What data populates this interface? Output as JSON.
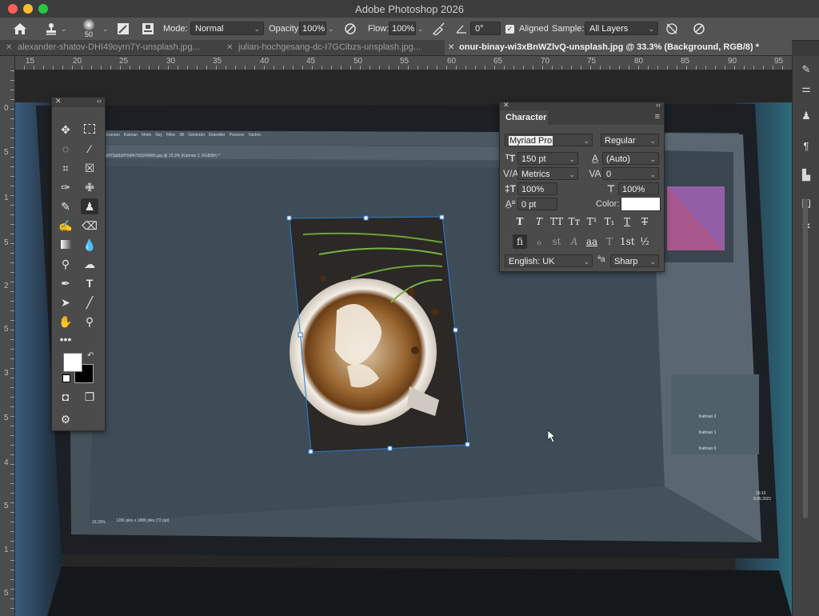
{
  "app": {
    "title": "Adobe Photoshop 2026"
  },
  "options_bar": {
    "brush_size": "50",
    "mode_label": "Mode:",
    "mode_value": "Normal",
    "opacity_label": "Opacity:",
    "opacity_value": "100%",
    "flow_label": "Flow:",
    "flow_value": "100%",
    "angle_value": "0°",
    "aligned_label": "Aligned",
    "sample_label": "Sample:",
    "sample_value": "All Layers"
  },
  "tabs": [
    {
      "label": "alexander-shatov-DHI49oyrn7Y-unsplash.jpg..."
    },
    {
      "label": "julian-hochgesang-dc-I7GCibzs-unsplash.jpg..."
    },
    {
      "label": "onur-binay-wi3xBnWZlvQ-unsplash.jpg @ 33.3% (Background, RGB/8) *"
    }
  ],
  "ruler": {
    "h_ticks": [
      "15",
      "20",
      "25",
      "30",
      "35",
      "40",
      "45",
      "50",
      "55",
      "60",
      "65",
      "70",
      "75",
      "80",
      "85",
      "90",
      "95"
    ],
    "v_ticks": [
      "0",
      "5",
      "1",
      "5",
      "2",
      "5",
      "3",
      "5",
      "4",
      "5",
      "1",
      "5"
    ]
  },
  "character_panel": {
    "title": "Character",
    "font_family": "Myriad Pro",
    "font_style": "Regular",
    "font_size": "150 pt",
    "leading": "(Auto)",
    "kerning": "Metrics",
    "tracking": "0",
    "vertical_scale": "100%",
    "horizontal_scale": "100%",
    "baseline_shift": "0 pt",
    "color_label": "Color:",
    "color_value": "#ffffff",
    "language": "English: UK",
    "antialias": "Sharp",
    "type_buttons": [
      "T",
      "T",
      "TT",
      "Tт",
      "T¹",
      "T₁",
      "T",
      "T"
    ],
    "opentype_buttons": [
      "fi",
      "ℴ",
      "st",
      "A",
      "aa",
      "T",
      "1st",
      "½"
    ]
  },
  "screen_content": {
    "menu": [
      "Görünüm",
      "Katman",
      "Metin",
      "Seç",
      "Filtre",
      "3B",
      "Görünüm",
      "Eklentiler",
      "Pencere",
      "Yardım"
    ],
    "tab": "e5f73a5b0f70df47f33249066.jpg @ 33,3% (Katman 2, RGB/8#) *",
    "layers": [
      "Katman 2",
      "Katman 1",
      "Katman 0"
    ],
    "status": "33,33%",
    "doc_size": "1280 piks x 1886 piks (72 ppi)",
    "clock_time": "16:15",
    "clock_date": "9.05.2021"
  },
  "colors": {
    "accent": "#2f7bd6",
    "panel": "#4b4b4b",
    "canvas": "#262626"
  }
}
